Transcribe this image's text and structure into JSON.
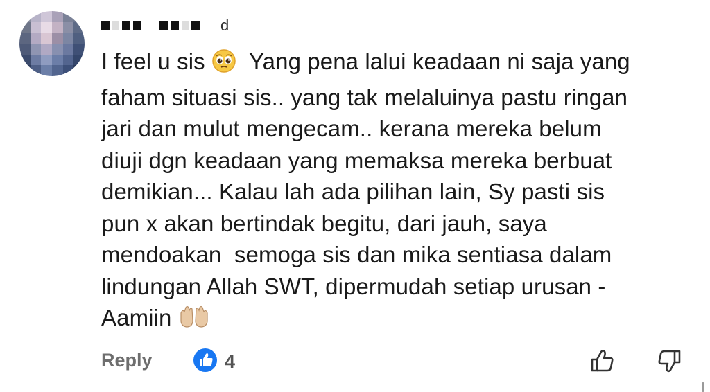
{
  "comment": {
    "author_visible_suffix": "d",
    "lines": [
      "I feel u sis",
      "faham situasi sis.. yang tak melaluinya pastu ringan",
      "jari dan mulut mengecam.. kerana mereka belum",
      "diuji dgn keadaan yang memaksa mereka berbuat",
      "demikian... Kalau lah ada pilihan lain, Sy pasti sis",
      "pun x akan bertindak begitu, dari jauh, saya",
      "mendoakan  semoga sis dan mika sentiasa dalam",
      "lindungan Allah SWT, dipermudah setiap urusan -",
      "Aamiin"
    ],
    "line1_after_emoji": "Yang pena lalui keadaan ni saja yang",
    "emojis": [
      "pleading-face-emoji",
      "open-hands-emoji"
    ]
  },
  "actions": {
    "reply_label": "Reply",
    "like_count": "4",
    "like_badge_icon": "thumbs-up-icon",
    "upvote_icon": "thumb-up-outline-icon",
    "downvote_icon": "thumb-down-outline-icon"
  },
  "colors": {
    "like_badge": "#1877f2",
    "reply_text": "#6e6e6e",
    "body_text": "#1a1a1a"
  }
}
